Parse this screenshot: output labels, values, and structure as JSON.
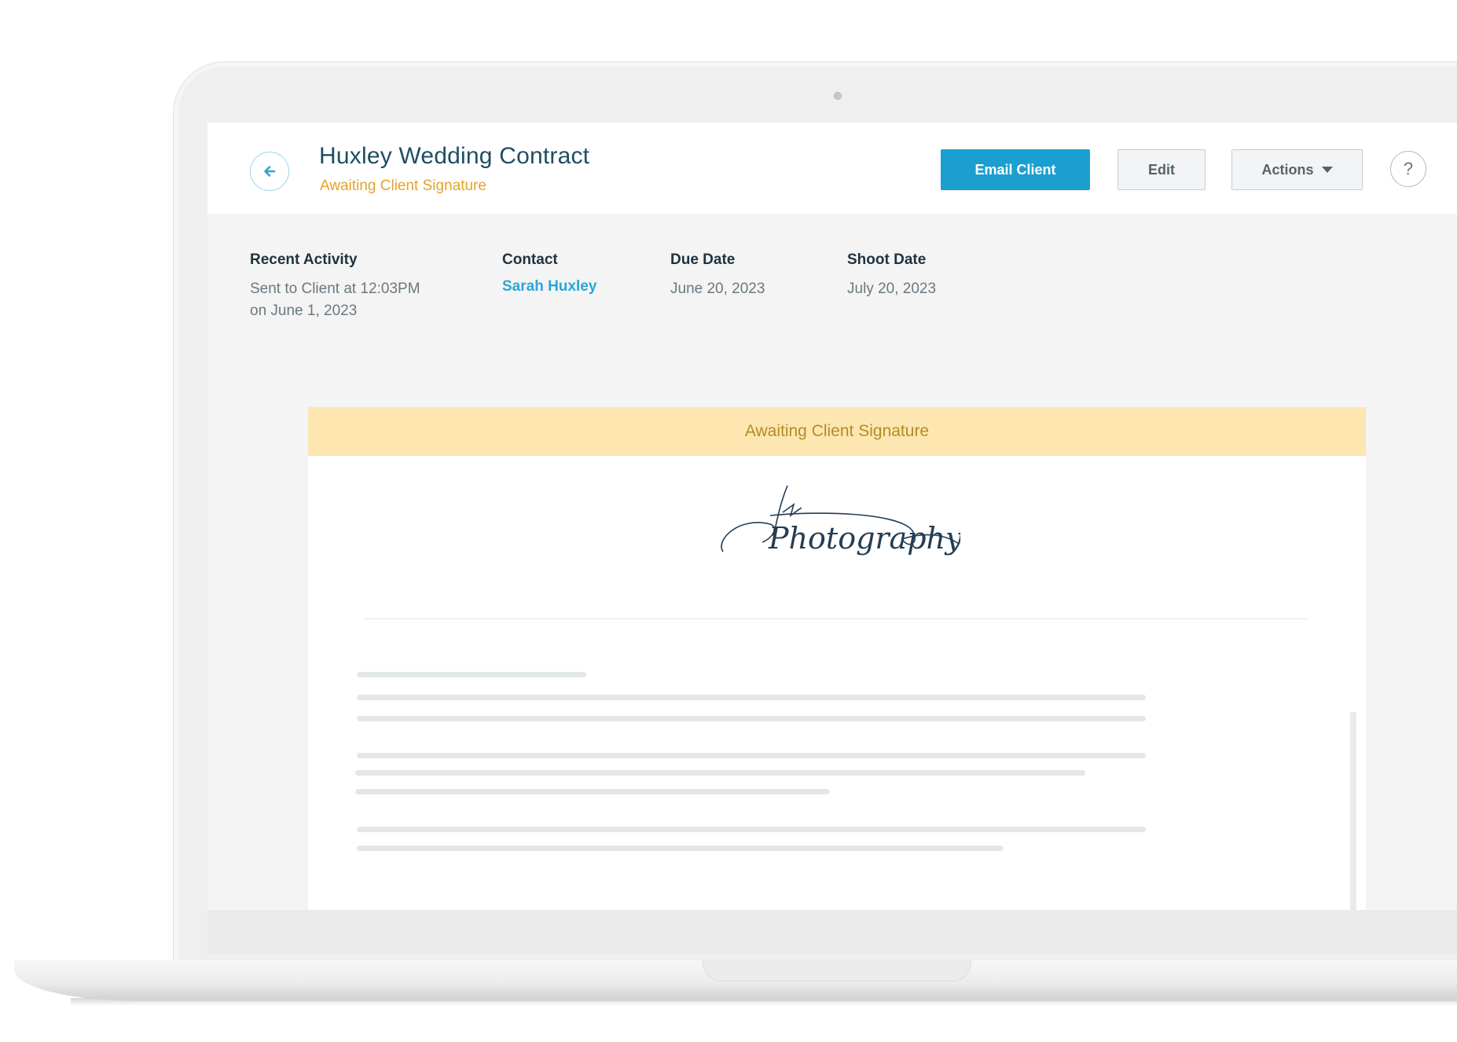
{
  "header": {
    "title": "Huxley Wedding Contract",
    "status": "Awaiting Client Signature",
    "email_button": "Email Client",
    "edit_button": "Edit",
    "actions_button": "Actions",
    "help_label": "?"
  },
  "info": {
    "recent_activity": {
      "label": "Recent Activity",
      "line1": "Sent to Client at 12:03PM",
      "line2": "on June 1, 2023"
    },
    "contact": {
      "label": "Contact",
      "value": "Sarah Huxley"
    },
    "due_date": {
      "label": "Due Date",
      "value": "June 20, 2023"
    },
    "shoot_date": {
      "label": "Shoot Date",
      "value": "July 20, 2023"
    }
  },
  "document": {
    "banner": "Awaiting Client Signature",
    "logo_text": "Photography"
  },
  "colors": {
    "primary": "#1b9fd0",
    "status_orange": "#e3a32e",
    "banner_bg": "#fde6b0",
    "link": "#2aa6d8"
  },
  "icons": {
    "back": "arrow-left-icon",
    "actions_caret": "caret-down-icon",
    "help": "question-mark-icon"
  }
}
